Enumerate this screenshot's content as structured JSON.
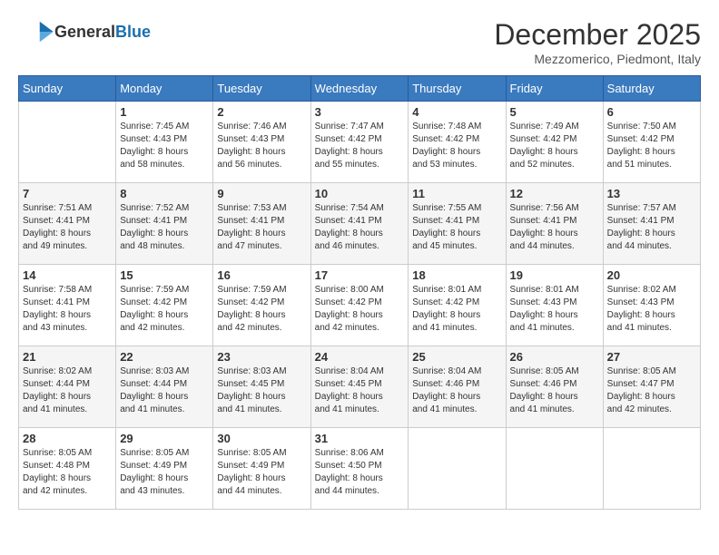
{
  "header": {
    "logo": {
      "general": "General",
      "blue": "Blue"
    },
    "title": "December 2025",
    "location": "Mezzomerico, Piedmont, Italy"
  },
  "calendar": {
    "days_of_week": [
      "Sunday",
      "Monday",
      "Tuesday",
      "Wednesday",
      "Thursday",
      "Friday",
      "Saturday"
    ],
    "weeks": [
      [
        {
          "day": "",
          "info": ""
        },
        {
          "day": "1",
          "info": "Sunrise: 7:45 AM\nSunset: 4:43 PM\nDaylight: 8 hours\nand 58 minutes."
        },
        {
          "day": "2",
          "info": "Sunrise: 7:46 AM\nSunset: 4:43 PM\nDaylight: 8 hours\nand 56 minutes."
        },
        {
          "day": "3",
          "info": "Sunrise: 7:47 AM\nSunset: 4:42 PM\nDaylight: 8 hours\nand 55 minutes."
        },
        {
          "day": "4",
          "info": "Sunrise: 7:48 AM\nSunset: 4:42 PM\nDaylight: 8 hours\nand 53 minutes."
        },
        {
          "day": "5",
          "info": "Sunrise: 7:49 AM\nSunset: 4:42 PM\nDaylight: 8 hours\nand 52 minutes."
        },
        {
          "day": "6",
          "info": "Sunrise: 7:50 AM\nSunset: 4:42 PM\nDaylight: 8 hours\nand 51 minutes."
        }
      ],
      [
        {
          "day": "7",
          "info": "Sunrise: 7:51 AM\nSunset: 4:41 PM\nDaylight: 8 hours\nand 49 minutes."
        },
        {
          "day": "8",
          "info": "Sunrise: 7:52 AM\nSunset: 4:41 PM\nDaylight: 8 hours\nand 48 minutes."
        },
        {
          "day": "9",
          "info": "Sunrise: 7:53 AM\nSunset: 4:41 PM\nDaylight: 8 hours\nand 47 minutes."
        },
        {
          "day": "10",
          "info": "Sunrise: 7:54 AM\nSunset: 4:41 PM\nDaylight: 8 hours\nand 46 minutes."
        },
        {
          "day": "11",
          "info": "Sunrise: 7:55 AM\nSunset: 4:41 PM\nDaylight: 8 hours\nand 45 minutes."
        },
        {
          "day": "12",
          "info": "Sunrise: 7:56 AM\nSunset: 4:41 PM\nDaylight: 8 hours\nand 44 minutes."
        },
        {
          "day": "13",
          "info": "Sunrise: 7:57 AM\nSunset: 4:41 PM\nDaylight: 8 hours\nand 44 minutes."
        }
      ],
      [
        {
          "day": "14",
          "info": "Sunrise: 7:58 AM\nSunset: 4:41 PM\nDaylight: 8 hours\nand 43 minutes."
        },
        {
          "day": "15",
          "info": "Sunrise: 7:59 AM\nSunset: 4:42 PM\nDaylight: 8 hours\nand 42 minutes."
        },
        {
          "day": "16",
          "info": "Sunrise: 7:59 AM\nSunset: 4:42 PM\nDaylight: 8 hours\nand 42 minutes."
        },
        {
          "day": "17",
          "info": "Sunrise: 8:00 AM\nSunset: 4:42 PM\nDaylight: 8 hours\nand 42 minutes."
        },
        {
          "day": "18",
          "info": "Sunrise: 8:01 AM\nSunset: 4:42 PM\nDaylight: 8 hours\nand 41 minutes."
        },
        {
          "day": "19",
          "info": "Sunrise: 8:01 AM\nSunset: 4:43 PM\nDaylight: 8 hours\nand 41 minutes."
        },
        {
          "day": "20",
          "info": "Sunrise: 8:02 AM\nSunset: 4:43 PM\nDaylight: 8 hours\nand 41 minutes."
        }
      ],
      [
        {
          "day": "21",
          "info": "Sunrise: 8:02 AM\nSunset: 4:44 PM\nDaylight: 8 hours\nand 41 minutes."
        },
        {
          "day": "22",
          "info": "Sunrise: 8:03 AM\nSunset: 4:44 PM\nDaylight: 8 hours\nand 41 minutes."
        },
        {
          "day": "23",
          "info": "Sunrise: 8:03 AM\nSunset: 4:45 PM\nDaylight: 8 hours\nand 41 minutes."
        },
        {
          "day": "24",
          "info": "Sunrise: 8:04 AM\nSunset: 4:45 PM\nDaylight: 8 hours\nand 41 minutes."
        },
        {
          "day": "25",
          "info": "Sunrise: 8:04 AM\nSunset: 4:46 PM\nDaylight: 8 hours\nand 41 minutes."
        },
        {
          "day": "26",
          "info": "Sunrise: 8:05 AM\nSunset: 4:46 PM\nDaylight: 8 hours\nand 41 minutes."
        },
        {
          "day": "27",
          "info": "Sunrise: 8:05 AM\nSunset: 4:47 PM\nDaylight: 8 hours\nand 42 minutes."
        }
      ],
      [
        {
          "day": "28",
          "info": "Sunrise: 8:05 AM\nSunset: 4:48 PM\nDaylight: 8 hours\nand 42 minutes."
        },
        {
          "day": "29",
          "info": "Sunrise: 8:05 AM\nSunset: 4:49 PM\nDaylight: 8 hours\nand 43 minutes."
        },
        {
          "day": "30",
          "info": "Sunrise: 8:05 AM\nSunset: 4:49 PM\nDaylight: 8 hours\nand 44 minutes."
        },
        {
          "day": "31",
          "info": "Sunrise: 8:06 AM\nSunset: 4:50 PM\nDaylight: 8 hours\nand 44 minutes."
        },
        {
          "day": "",
          "info": ""
        },
        {
          "day": "",
          "info": ""
        },
        {
          "day": "",
          "info": ""
        }
      ]
    ]
  }
}
